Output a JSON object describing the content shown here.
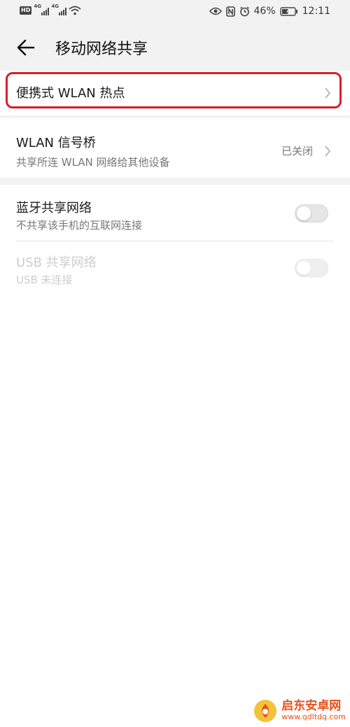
{
  "status_bar": {
    "hd": "HD",
    "sim1_tag": "4G",
    "sim2_tag": "4G",
    "battery_percent": "46%",
    "time": "12:11",
    "icons": [
      "wifi-icon",
      "eye-icon",
      "nfc-icon",
      "alarm-icon",
      "battery-icon"
    ]
  },
  "header": {
    "title": "移动网络共享",
    "back_icon": "arrow-left-icon"
  },
  "hotspot": {
    "label": "便携式 WLAN 热点",
    "highlight_color": "#d61f2c"
  },
  "bridge": {
    "label": "WLAN 信号桥",
    "subtitle": "共享所连 WLAN 网络给其他设备",
    "value": "已关闭"
  },
  "bluetooth_share": {
    "label": "蓝牙共享网络",
    "subtitle": "不共享该手机的互联网连接",
    "enabled": false
  },
  "usb_share": {
    "label": "USB 共享网络",
    "subtitle": "USB 未连接",
    "enabled": false,
    "disabled": true
  },
  "watermark": {
    "name": "启东安卓网",
    "url": "www.qdltdq.com"
  }
}
